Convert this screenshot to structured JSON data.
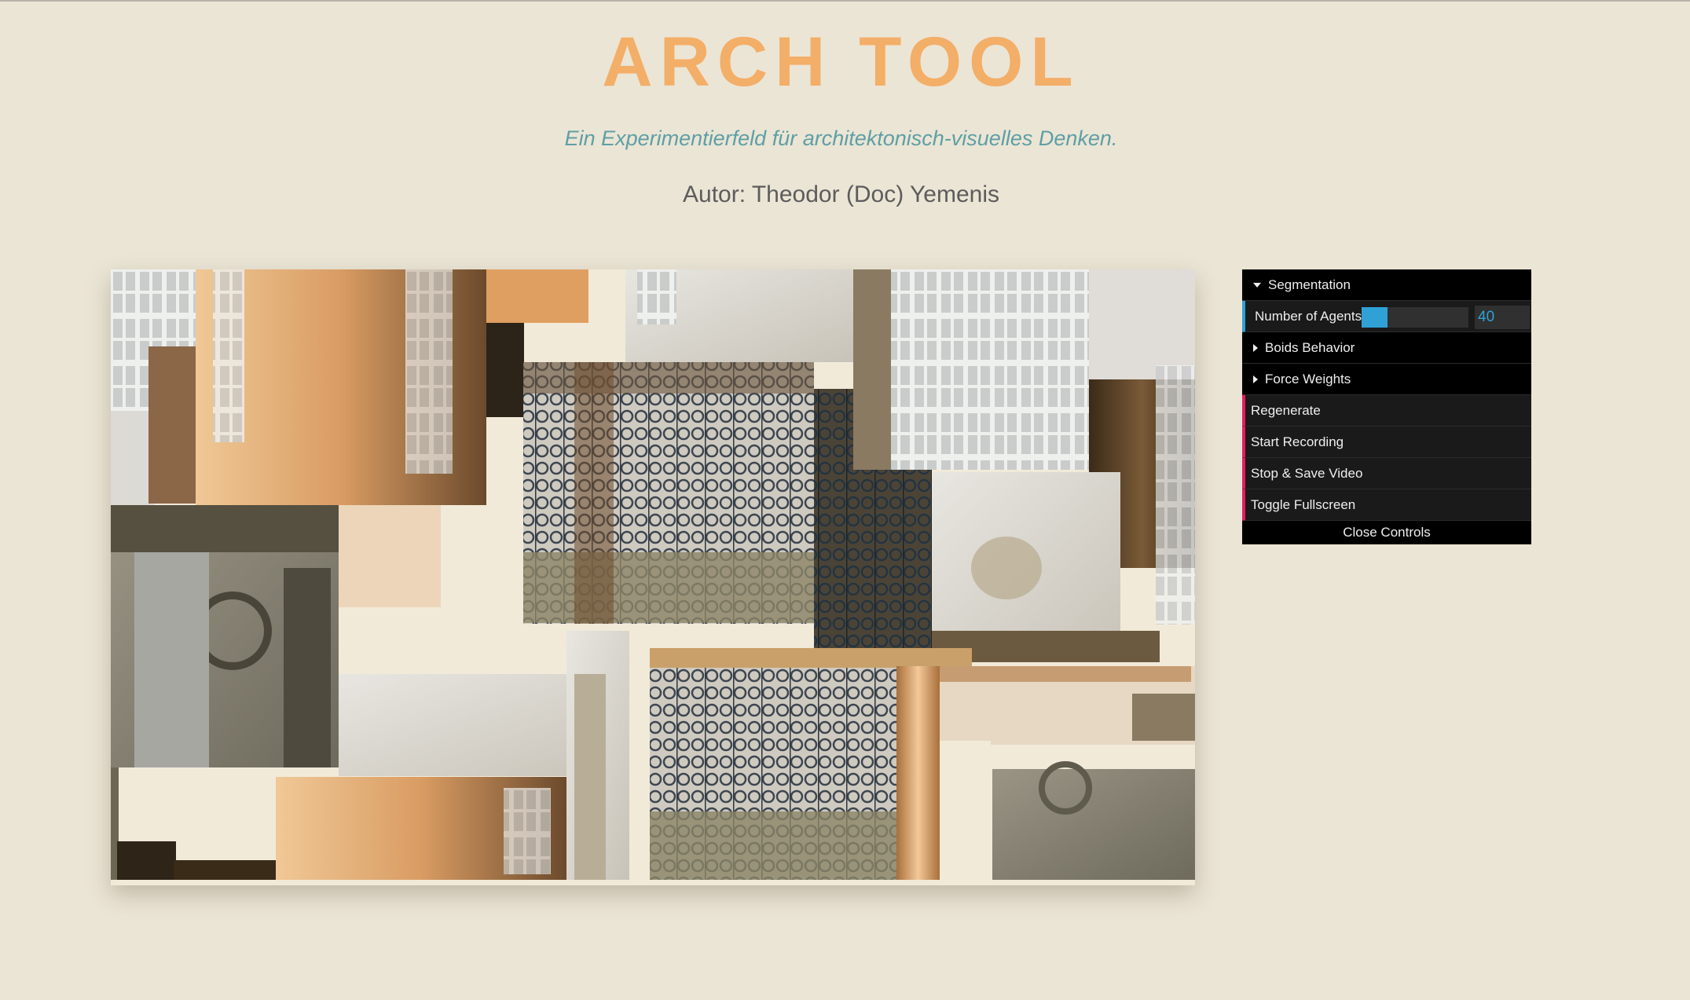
{
  "header": {
    "title": "ARCH TOOL",
    "subtitle": "Ein Experimentierfeld für architektonisch-visuelles Denken.",
    "author": "Autor: Theodor (Doc) Yemenis"
  },
  "colors": {
    "background": "#ebe5d5",
    "title": "#f3ae68",
    "subtitle": "#5e9fa5",
    "gui_number_accent": "#2fa1d6",
    "gui_button_accent": "#e61d5f"
  },
  "controls": {
    "folders": {
      "segmentation": "Segmentation",
      "boids": "Boids Behavior",
      "force": "Force Weights"
    },
    "agents": {
      "label": "Number of Agents",
      "value": "40",
      "fill_fraction": 0.24
    },
    "buttons": {
      "regenerate": "Regenerate",
      "start_recording": "Start Recording",
      "stop_save": "Stop & Save Video",
      "fullscreen": "Toggle Fullscreen"
    },
    "close": "Close Controls"
  },
  "canvas": {
    "content": "collage of architecture photo fragments: windows, wrought-iron balconies, stone corbels"
  }
}
